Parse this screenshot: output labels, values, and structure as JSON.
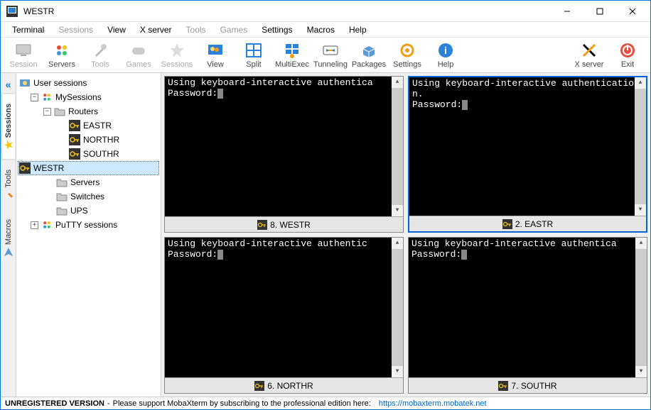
{
  "window": {
    "title": "WESTR"
  },
  "menu": {
    "terminal": "Terminal",
    "sessions": "Sessions",
    "view": "View",
    "xserver": "X server",
    "tools": "Tools",
    "games": "Games",
    "settings": "Settings",
    "macros": "Macros",
    "help": "Help"
  },
  "toolbar": {
    "session": "Session",
    "servers": "Servers",
    "tools": "Tools",
    "games": "Games",
    "sessions": "Sessions",
    "view": "View",
    "split": "Split",
    "multiexec": "MultiExec",
    "tunneling": "Tunneling",
    "packages": "Packages",
    "settings": "Settings",
    "help": "Help",
    "xserver": "X server",
    "exit": "Exit"
  },
  "sidetabs": {
    "sessions": "Sessions",
    "tools": "Tools",
    "macros": "Macros"
  },
  "tree": {
    "user_sessions": "User sessions",
    "mysessions": "MySessions",
    "routers": "Routers",
    "eastr": "EASTR",
    "northr": "NORTHR",
    "southr": "SOUTHR",
    "westr": "WESTR",
    "servers": "Servers",
    "switches": "Switches",
    "ups": "UPS",
    "putty_sessions": "PuTTY sessions"
  },
  "terminals": [
    {
      "tab_label": "8. WESTR",
      "content": "Using keyboard-interactive authentica\nPassword:",
      "active": false
    },
    {
      "tab_label": "2. EASTR",
      "content": "Using keyboard-interactive authentication.\nPassword:",
      "active": true
    },
    {
      "tab_label": "6. NORTHR",
      "content": "Using keyboard-interactive authentic\nPassword:",
      "active": false
    },
    {
      "tab_label": "7. SOUTHR",
      "content": "Using keyboard-interactive authentica\nPassword:",
      "active": false
    }
  ],
  "status": {
    "unregistered": "UNREGISTERED VERSION",
    "dash": " - ",
    "message": "Please support MobaXterm by subscribing to the professional edition here:",
    "link": "https://mobaxterm.mobatek.net"
  }
}
